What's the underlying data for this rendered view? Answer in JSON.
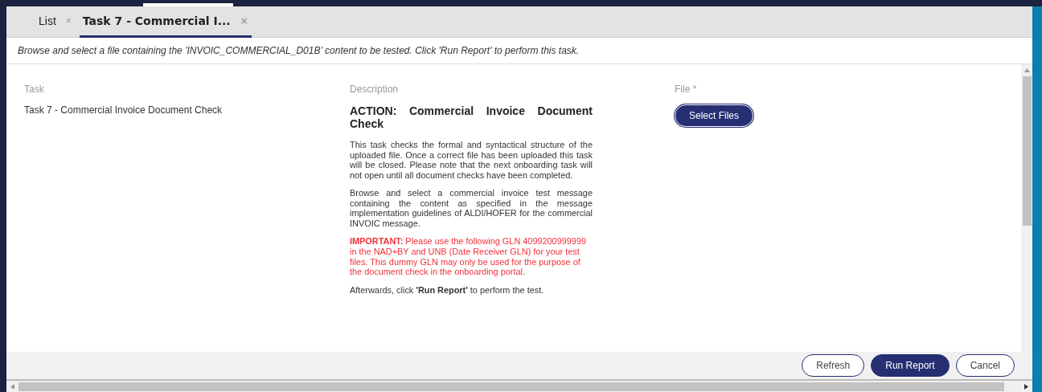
{
  "tabs": [
    {
      "label": "List",
      "selected": false,
      "close": "×"
    },
    {
      "label": "Task 7 - Commercial I...",
      "selected": true,
      "close": "×"
    }
  ],
  "instruction": "Browse and select a file containing the 'INVOIC_COMMERCIAL_D01B' content to be tested. Click 'Run Report' to perform this task.",
  "task": {
    "label": "Task",
    "value": "Task 7 - Commercial Invoice Document Check"
  },
  "description": {
    "label": "Description",
    "heading": "ACTION: Commercial Invoice Document Check",
    "paragraphs": [
      {
        "kind": "normal",
        "text": "This task checks the formal and syntactical structure of the uploaded file. Once a correct file has been uploaded this task will be closed. Please note that the next onboarding task will not open until all document checks have been completed."
      },
      {
        "kind": "normal",
        "text": "Browse and select a commercial invoice test message containing the content as specified in the message implementation guidelines of ALDI/HOFER for the commercial INVOIC message."
      },
      {
        "kind": "warning",
        "text": "**IMPORTANT:** Please use the following GLN 4099200999999 in the NAD+BY and UNB (Date Receiver GLN) for your test files. This dummy GLN may only be used for the purpose of the document check in the onboarding portal."
      },
      {
        "kind": "normal",
        "text": "Afterwards, click **'Run Report'** to perform the test."
      }
    ]
  },
  "file": {
    "label": "File *",
    "button": "Select Files"
  },
  "buttons": [
    {
      "label": "Refresh",
      "kind": "outline"
    },
    {
      "label": "Run Report",
      "kind": "primary"
    },
    {
      "label": "Cancel",
      "kind": "outline"
    }
  ]
}
